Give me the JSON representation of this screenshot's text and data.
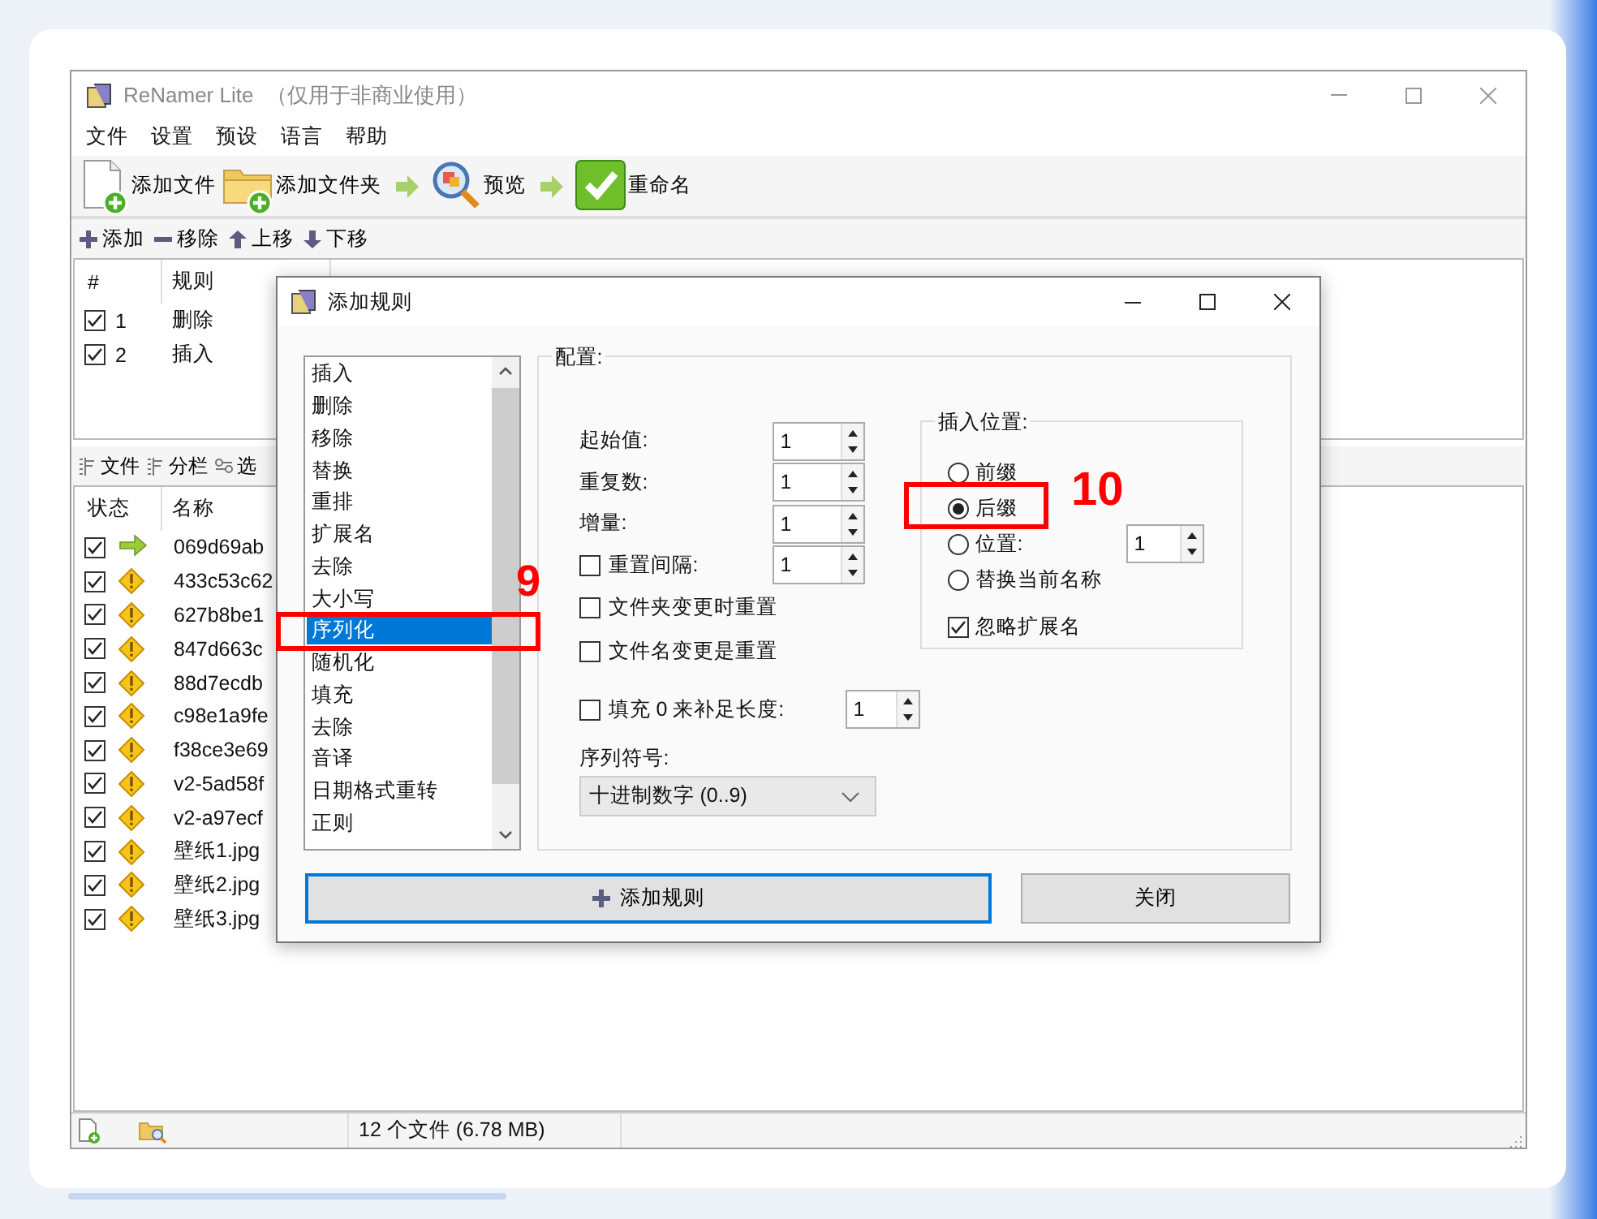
{
  "window": {
    "title": "ReNamer Lite",
    "subtitle": "（仅用于非商业使用）"
  },
  "menu": [
    "文件",
    "设置",
    "预设",
    "语言",
    "帮助"
  ],
  "toolbar": [
    {
      "kind": "add-file",
      "label": "添加文件"
    },
    {
      "kind": "add-folder",
      "label": "添加文件夹"
    },
    {
      "kind": "arrow"
    },
    {
      "kind": "preview",
      "label": "预览"
    },
    {
      "kind": "arrow"
    },
    {
      "kind": "rename",
      "label": "重命名"
    }
  ],
  "rule_toolbar": [
    {
      "kind": "add",
      "label": "添加"
    },
    {
      "kind": "remove",
      "label": "移除"
    },
    {
      "kind": "up",
      "label": "上移"
    },
    {
      "kind": "down",
      "label": "下移"
    }
  ],
  "rules_table": {
    "columns": [
      "#",
      "规则"
    ],
    "rows": [
      {
        "checked": true,
        "number": "1",
        "rule": "删除"
      },
      {
        "checked": true,
        "number": "2",
        "rule": "插入"
      }
    ]
  },
  "file_tabs": [
    {
      "kind": "list",
      "label": "文件"
    },
    {
      "kind": "list",
      "label": "分栏"
    },
    {
      "kind": "options",
      "label": "选"
    }
  ],
  "files_table": {
    "columns": [
      "状态",
      "名称"
    ],
    "rows": [
      {
        "checked": true,
        "kind": "ok",
        "name": "069d69ab"
      },
      {
        "checked": true,
        "kind": "warning",
        "name": "433c53c62"
      },
      {
        "checked": true,
        "kind": "warning",
        "name": "627b8be1"
      },
      {
        "checked": true,
        "kind": "warning",
        "name": "847d663c"
      },
      {
        "checked": true,
        "kind": "warning",
        "name": "88d7ecdb"
      },
      {
        "checked": true,
        "kind": "warning",
        "name": "c98e1a9fe"
      },
      {
        "checked": true,
        "kind": "warning",
        "name": "f38ce3e69"
      },
      {
        "checked": true,
        "kind": "warning",
        "name": "v2-5ad58f"
      },
      {
        "checked": true,
        "kind": "warning",
        "name": "v2-a97ecf"
      },
      {
        "checked": true,
        "kind": "warning",
        "name": "壁纸1.jpg"
      },
      {
        "checked": true,
        "kind": "warning",
        "name": "壁纸2.jpg"
      },
      {
        "checked": true,
        "kind": "warning",
        "name": "壁纸3.jpg"
      }
    ]
  },
  "status_bar": {
    "file_count": "12 个文件 (6.78 MB)"
  },
  "dialog": {
    "title": "添加规则",
    "rule_list": [
      {
        "label": "插入",
        "selected": false
      },
      {
        "label": "删除",
        "selected": false
      },
      {
        "label": "移除",
        "selected": false
      },
      {
        "label": "替换",
        "selected": false
      },
      {
        "label": "重排",
        "selected": false
      },
      {
        "label": "扩展名",
        "selected": false
      },
      {
        "label": "去除",
        "selected": false
      },
      {
        "label": "大小写",
        "selected": false
      },
      {
        "label": "序列化",
        "selected": true
      },
      {
        "label": "随机化",
        "selected": false
      },
      {
        "label": "填充",
        "selected": false
      },
      {
        "label": "去除",
        "selected": false
      },
      {
        "label": "音译",
        "selected": false
      },
      {
        "label": "日期格式重转",
        "selected": false
      },
      {
        "label": "正则",
        "selected": false
      }
    ],
    "config": {
      "legend": "配置:",
      "spinners": [
        {
          "kind": "plain",
          "label": "起始值:",
          "value": "1"
        },
        {
          "kind": "plain",
          "label": "重复数:",
          "value": "1"
        },
        {
          "kind": "plain",
          "label": "增量:",
          "value": "1"
        },
        {
          "kind": "checkbox",
          "label": "重置间隔:",
          "value": "1",
          "checked": false
        }
      ],
      "checkboxes": [
        {
          "label": "文件夹变更时重置",
          "checked": false
        },
        {
          "label": "文件名变更是重置",
          "checked": false
        }
      ],
      "padding": {
        "label": "填充 0 来补足长度:",
        "checked": false,
        "value": "1"
      },
      "sequence": {
        "label": "序列符号:",
        "value": "十进制数字 (0..9)"
      },
      "insert_position": {
        "legend": "插入位置:",
        "options": [
          {
            "label": "前缀",
            "selected": false
          },
          {
            "label": "后缀",
            "selected": true
          },
          {
            "label": "位置:",
            "selected": false
          },
          {
            "label": "替换当前名称",
            "selected": false
          }
        ],
        "position_value": "1",
        "ignore_extension": {
          "label": "忽略扩展名",
          "checked": true
        }
      }
    },
    "buttons": [
      {
        "kind": "primary",
        "label": "添加规则"
      },
      {
        "kind": "plain",
        "label": "关闭"
      }
    ]
  },
  "annotations": [
    {
      "kind": "rule-list",
      "label": "9"
    },
    {
      "kind": "insert-position",
      "label": "10"
    }
  ]
}
